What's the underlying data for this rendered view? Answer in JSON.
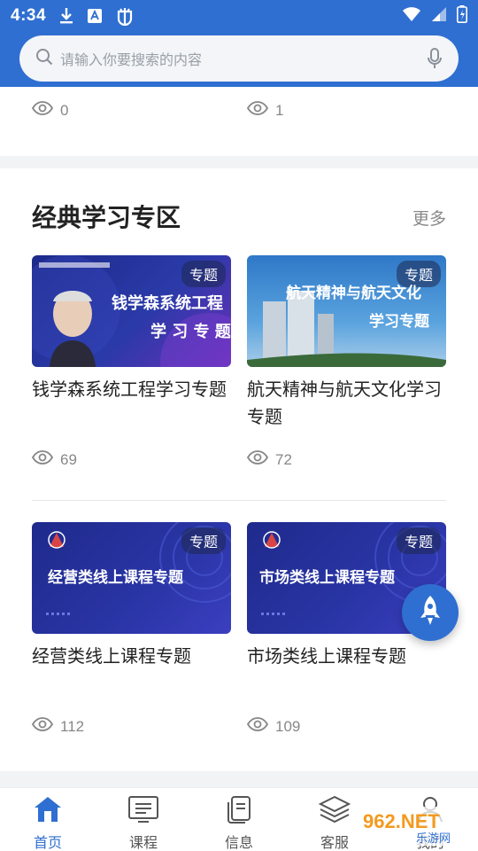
{
  "status_bar": {
    "time": "4:34"
  },
  "search": {
    "placeholder": "请输入你要搜索的内容"
  },
  "top_card": {
    "views_left": "0",
    "views_right": "1"
  },
  "section": {
    "title": "经典学习专区",
    "more_label": "更多",
    "items": [
      {
        "badge": "专题",
        "thumb_line1": "钱学森系统工程",
        "thumb_line2": "学 习 专 题",
        "title": "钱学森系统工程学习专题",
        "views": "69"
      },
      {
        "badge": "专题",
        "thumb_line1": "航天精神与航天文化",
        "thumb_line2": "学习专题",
        "title": "航天精神与航天文化学习专题",
        "views": "72"
      },
      {
        "badge": "专题",
        "thumb_line1": "经营类线上课程专题",
        "title": "经营类线上课程专题",
        "views": "112"
      },
      {
        "badge": "专题",
        "thumb_line1": "市场类线上课程专题",
        "title": "市场类线上课程专题",
        "views": "109"
      }
    ]
  },
  "tabbar": {
    "tabs": [
      {
        "label": "首页",
        "icon": "home-icon"
      },
      {
        "label": "课程",
        "icon": "course-list-icon"
      },
      {
        "label": "信息",
        "icon": "info-icon"
      },
      {
        "label": "客服",
        "icon": "layers-icon"
      },
      {
        "label": "我的",
        "icon": "user-icon"
      }
    ]
  },
  "watermark": {
    "text": "962.NET",
    "subtext": "乐游网"
  },
  "colors": {
    "primary": "#2f6fd1",
    "banner_dark": "#1f2a8c"
  }
}
